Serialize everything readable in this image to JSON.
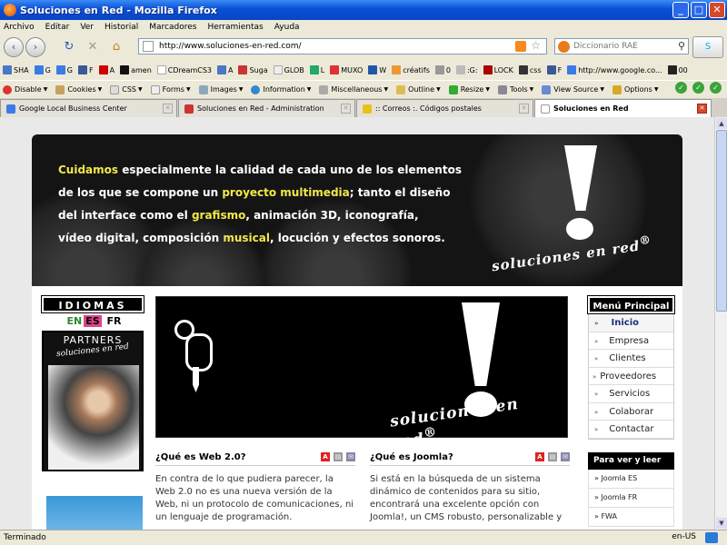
{
  "window": {
    "title": "Soluciones en Red - Mozilla Firefox",
    "min": "_",
    "max": "□",
    "close": "✕"
  },
  "menu": [
    "Archivo",
    "Editar",
    "Ver",
    "Historial",
    "Marcadores",
    "Herramientas",
    "Ayuda"
  ],
  "nav": {
    "back": "‹",
    "forward": "›",
    "reload": "↻",
    "stop": "✕",
    "home": "⌂",
    "url": "http://www.soluciones-en-red.com/",
    "search_placeholder": "Diccionario RAE",
    "star": "☆",
    "magnifier": "⚲",
    "skype": "S"
  },
  "bookmarks": [
    "SHA",
    "G",
    "G",
    "F",
    "A",
    "amen",
    "CDreamCS3",
    "A",
    "Suga",
    "GLOB",
    "L",
    "MUXO",
    "W",
    "créatifs",
    "0",
    ":G:",
    "LOCK",
    "css",
    "F",
    "http://www.google.co...",
    "00"
  ],
  "devtools": [
    "Disable",
    "Cookies",
    "CSS",
    "Forms",
    "Images",
    "Information",
    "Miscellaneous",
    "Outline",
    "Resize",
    "Tools",
    "View Source",
    "Options"
  ],
  "tabs": [
    {
      "label": "Google Local Business Center",
      "active": false
    },
    {
      "label": "Soluciones en Red - Administration",
      "active": false
    },
    {
      "label": ":: Correos :. Códigos postales",
      "active": false
    },
    {
      "label": "Soluciones en Red",
      "active": true
    }
  ],
  "banner": {
    "lines": [
      [
        {
          "t": "Cuidamos",
          "y": true
        },
        {
          "t": " especialmente la calidad de cada uno de los elementos",
          "y": false
        }
      ],
      [
        {
          "t": "de los que se compone un ",
          "y": false
        },
        {
          "t": "proyecto multimedia",
          "y": true
        },
        {
          "t": "; tanto el diseño",
          "y": false
        }
      ],
      [
        {
          "t": "del interface como el ",
          "y": false
        },
        {
          "t": "grafismo",
          "y": true
        },
        {
          "t": ", animación 3D, iconografía,",
          "y": false
        }
      ],
      [
        {
          "t": "vídeo digital, composición ",
          "y": false
        },
        {
          "t": "musical",
          "y": true
        },
        {
          "t": ", locución y efectos sonoros.",
          "y": false
        }
      ]
    ],
    "logo": "soluciones en red",
    "reg": "®"
  },
  "idiomas": {
    "title": "IDIOMAS",
    "en": "EN",
    "es": "ES",
    "fr": "FR"
  },
  "partners": {
    "title": "PARTNERS",
    "logo": "soluciones en red"
  },
  "center_logo": "soluciones en red",
  "articles": [
    {
      "title": "¿Qué es Web 2.0?",
      "body": "En contra de lo que pudiera parecer, la Web 2.0 no es una nueva versión de la Web, ni un protocolo de comunicaciones, ni un lenguaje de programación."
    },
    {
      "title": "¿Qué es Joomla?",
      "body": "Si está en la búsqueda de un sistema dinámico de contenidos para su sitio, encontrará una excelente opción con Joomla!, un CMS robusto, personalizable y"
    }
  ],
  "menu_principal": {
    "title": "Menú Principal",
    "items": [
      "Inicio",
      "Empresa",
      "Clientes",
      "Proveedores",
      "Servicios",
      "Colaborar",
      "Contactar"
    ]
  },
  "para_ver": {
    "title": "Para ver y leer",
    "items": [
      "Joomla ES",
      "Joomla FR",
      "FWA"
    ]
  },
  "status": {
    "text": "Terminado",
    "locale": "en-US"
  }
}
